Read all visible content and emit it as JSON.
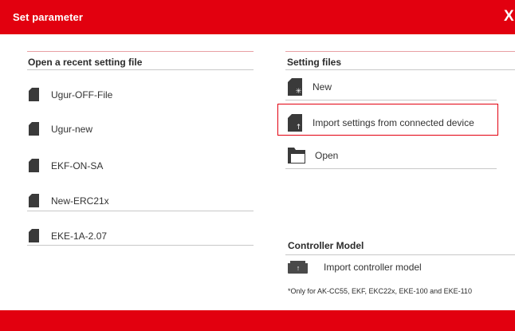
{
  "dialog": {
    "title": "Set parameter",
    "close_label": "X"
  },
  "recent": {
    "heading": "Open a recent setting file",
    "files": [
      {
        "label": "Ugur-OFF-File",
        "icon": "file-icon"
      },
      {
        "label": "Ugur-new",
        "icon": "file-icon"
      },
      {
        "label": "EKF-ON-SA",
        "icon": "file-icon"
      },
      {
        "label": "New-ERC21x",
        "icon": "file-icon"
      },
      {
        "label": "EKE-1A-2.07",
        "icon": "file-icon"
      }
    ]
  },
  "setting_files": {
    "heading": "Setting files",
    "new_label": "New",
    "import_label": "Import settings from connected device",
    "open_label": "Open"
  },
  "controller_model": {
    "heading": "Controller Model",
    "import_label": "Import controller model",
    "note": "*Only for AK-CC55, EKF, EKC22x, EKE-100 and EKE-110"
  },
  "colors": {
    "accent": "#e2000f",
    "icon": "#3a3a3a"
  }
}
